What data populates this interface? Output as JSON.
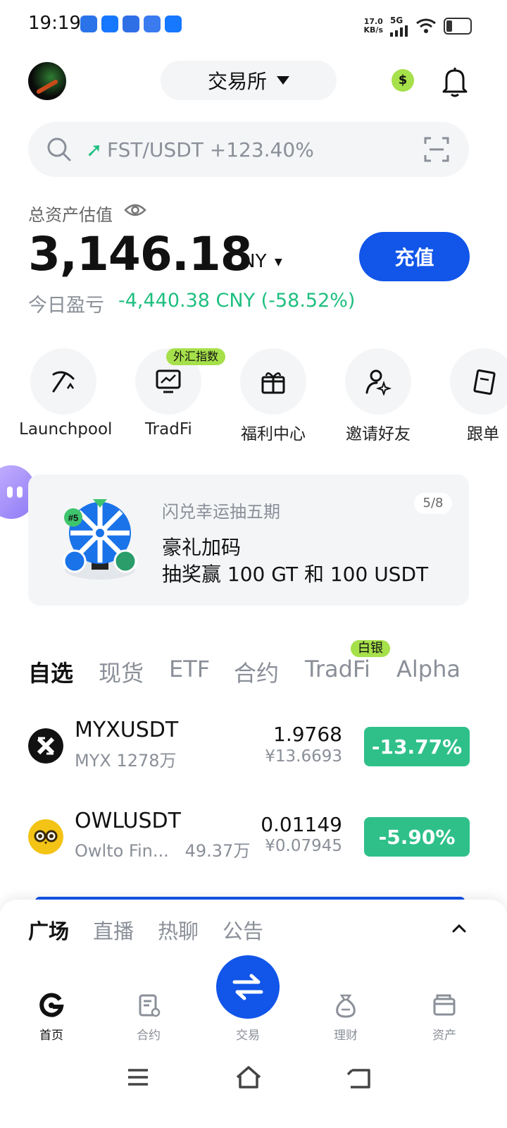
{
  "status_bar": {
    "time": "19:19",
    "speed_top": "17.0",
    "speed_bottom": "KB/s",
    "network": "5G",
    "app_colors": [
      "#2a73e8",
      "#1677ff",
      "#2f6fe6",
      "#3a7bf0",
      "#1677ff"
    ]
  },
  "header": {
    "exchange_label": "交易所",
    "dollar_glyph": "$"
  },
  "search": {
    "ticker": "FST/USDT +123.40%",
    "arrow": "➚"
  },
  "assets": {
    "label": "总资产估值",
    "amount": "3,146.18",
    "currency": "CNY",
    "caret": "▼",
    "deposit_label": "充值",
    "pnl_label": "今日盈亏",
    "pnl_value": "-4,440.38 CNY (-58.52%)"
  },
  "shortcuts": [
    {
      "label": "Launchpool",
      "icon": "pickaxe-icon"
    },
    {
      "label": "TradFi",
      "icon": "chart-monitor-icon",
      "badge": "外汇指数"
    },
    {
      "label": "福利中心",
      "icon": "gift-icon"
    },
    {
      "label": "邀请好友",
      "icon": "user-star-icon"
    },
    {
      "label": "跟单",
      "icon": "cards-icon"
    }
  ],
  "banner": {
    "tag": "闪兑幸运抽五期",
    "page": "5/8",
    "line1": "豪礼加码",
    "line2": "抽奖赢 100 GT 和 100 USDT",
    "badge": "#5"
  },
  "market_tabs": {
    "items": [
      "自选",
      "现货",
      "ETF",
      "合约",
      "TradFi",
      "Alpha"
    ],
    "active": "自选",
    "badge": "白银"
  },
  "market_rows": [
    {
      "pair": "MYXUSDT",
      "sub": "MYX 1278万",
      "price": "1.9768",
      "price_cny": "¥13.6693",
      "change": "-13.77%"
    },
    {
      "pair": "OWLUSDT",
      "sub": "Owlto Fin...   49.37万",
      "price": "0.01149",
      "price_cny": "¥0.07945",
      "change": "-5.90%"
    }
  ],
  "sheet_tabs": {
    "items": [
      "广场",
      "直播",
      "热聊",
      "公告"
    ],
    "active": "广场"
  },
  "bottom_nav": {
    "home": "首页",
    "futures": "合约",
    "trade": "交易",
    "earn": "理财",
    "assets": "资产"
  },
  "colors": {
    "accent": "#1155e9",
    "positive": "#1fbf80",
    "change_bg": "#2fc08a",
    "lime": "#a6e04a"
  }
}
